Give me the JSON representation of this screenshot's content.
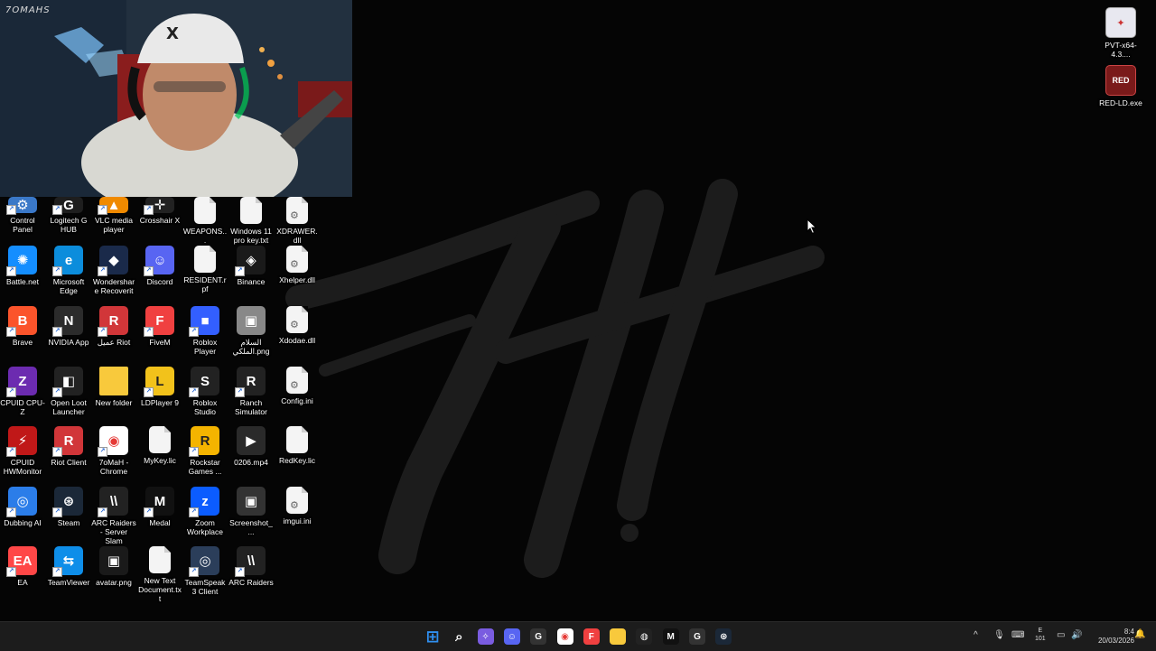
{
  "webcam": {
    "overlay_label": "7OMAHS"
  },
  "desktop_icons_left": [
    {
      "label": "Control Panel",
      "icon": "control-panel-icon",
      "color": "#3a78c8"
    },
    {
      "label": "Logitech G HUB",
      "icon": "logitech-ghub-icon",
      "color": "#1e1e1e"
    },
    {
      "label": "VLC media player",
      "icon": "vlc-icon",
      "color": "#f08a00"
    },
    {
      "label": "Crosshair X",
      "icon": "crosshair-x-icon",
      "color": "#222"
    },
    {
      "label": "WEAPONS...",
      "icon": "file-icon",
      "color": "#f4f4f4"
    },
    {
      "label": "Windows 11 pro key.txt",
      "icon": "text-file-icon",
      "color": "#f4f4f4"
    },
    {
      "label": "XDRAWER.dll",
      "icon": "dll-file-icon",
      "color": "#f4f4f4"
    },
    {
      "label": "Battle.net",
      "icon": "battlenet-icon",
      "color": "#148eff"
    },
    {
      "label": "Microsoft Edge",
      "icon": "edge-icon",
      "color": "#0c8ddc"
    },
    {
      "label": "Wondershare Recoverit",
      "icon": "recoverit-icon",
      "color": "#1a2a4a"
    },
    {
      "label": "Discord",
      "icon": "discord-icon",
      "color": "#5865f2"
    },
    {
      "label": "RESIDENT.rpf",
      "icon": "file-icon",
      "color": "#f4f4f4"
    },
    {
      "label": "Binance",
      "icon": "binance-icon",
      "color": "#1a1a1a"
    },
    {
      "label": "Xhelper.dll",
      "icon": "dll-file-icon",
      "color": "#f4f4f4"
    },
    {
      "label": "Brave",
      "icon": "brave-icon",
      "color": "#fb542b"
    },
    {
      "label": "NVIDIA App",
      "icon": "nvidia-icon",
      "color": "#2b2b2b"
    },
    {
      "label": "عميل Riot",
      "icon": "riot-client-icon",
      "color": "#d13639"
    },
    {
      "label": "FiveM",
      "icon": "fivem-icon",
      "color": "#f04040"
    },
    {
      "label": "Roblox Player",
      "icon": "roblox-icon",
      "color": "#335fff"
    },
    {
      "label": "السلام الملكي.png",
      "icon": "image-file-icon",
      "color": "#888"
    },
    {
      "label": "Xdodae.dll",
      "icon": "dll-file-icon",
      "color": "#f4f4f4"
    },
    {
      "label": "CPUID CPU-Z",
      "icon": "cpuz-icon",
      "color": "#6c2bb0"
    },
    {
      "label": "Open Loot Launcher",
      "icon": "openloot-icon",
      "color": "#222"
    },
    {
      "label": "New folder",
      "icon": "folder-icon",
      "color": "#f8c93c"
    },
    {
      "label": "LDPlayer 9",
      "icon": "ldplayer-icon",
      "color": "#f2c21b"
    },
    {
      "label": "Roblox Studio",
      "icon": "roblox-studio-icon",
      "color": "#222"
    },
    {
      "label": "Ranch Simulator",
      "icon": "ranch-simulator-icon",
      "color": "#222"
    },
    {
      "label": "Config.ini",
      "icon": "ini-file-icon",
      "color": "#f4f4f4"
    },
    {
      "label": "CPUID HWMonitor",
      "icon": "hwmonitor-icon",
      "color": "#c01818"
    },
    {
      "label": "Riot Client",
      "icon": "riot-client-icon",
      "color": "#d13639"
    },
    {
      "label": "7oMaH - Chrome",
      "icon": "chrome-icon",
      "color": "#ffffff"
    },
    {
      "label": "MyKey.lic",
      "icon": "file-icon",
      "color": "#f4f4f4"
    },
    {
      "label": "Rockstar Games ...",
      "icon": "rockstar-icon",
      "color": "#f4b400"
    },
    {
      "label": "0206.mp4",
      "icon": "video-file-icon",
      "color": "#2a2a2a"
    },
    {
      "label": "RedKey.lic",
      "icon": "file-icon",
      "color": "#f4f4f4"
    },
    {
      "label": "Dubbing AI",
      "icon": "dubbing-ai-icon",
      "color": "#2b7de9"
    },
    {
      "label": "Steam",
      "icon": "steam-icon",
      "color": "#1b2838"
    },
    {
      "label": "ARC Raiders - Server Slam",
      "icon": "arc-raiders-icon",
      "color": "#222"
    },
    {
      "label": "Medal",
      "icon": "medal-icon",
      "color": "#111"
    },
    {
      "label": "Zoom Workplace",
      "icon": "zoom-icon",
      "color": "#0b5cff"
    },
    {
      "label": "Screenshot_...",
      "icon": "image-file-icon",
      "color": "#333"
    },
    {
      "label": "imgui.ini",
      "icon": "ini-file-icon",
      "color": "#f4f4f4"
    },
    {
      "label": "EA",
      "icon": "ea-icon",
      "color": "#ff4747"
    },
    {
      "label": "TeamViewer",
      "icon": "teamviewer-icon",
      "color": "#0e8ee9"
    },
    {
      "label": "avatar.png",
      "icon": "image-file-icon",
      "color": "#1a1a1a"
    },
    {
      "label": "New Text Document.txt",
      "icon": "text-file-icon",
      "color": "#f4f4f4"
    },
    {
      "label": "TeamSpeak 3 Client",
      "icon": "teamspeak-icon",
      "color": "#2b3e5a"
    },
    {
      "label": "ARC Raiders",
      "icon": "arc-raiders-icon",
      "color": "#222"
    }
  ],
  "desktop_icons_right": [
    {
      "label": "PVT-x64-4.3....",
      "icon": "pvt-exe-icon"
    },
    {
      "label": "RED-LD.exe",
      "icon": "red-ld-exe-icon"
    }
  ],
  "taskbar": {
    "apps": [
      {
        "name": "start-button",
        "icon": "windows-logo-icon",
        "color": "#2f8ff0"
      },
      {
        "name": "search-button",
        "icon": "search-icon",
        "color": "transparent"
      },
      {
        "name": "copilot-button",
        "icon": "copilot-icon",
        "color": "#7a5ce0"
      },
      {
        "name": "discord-taskbar",
        "icon": "discord-icon",
        "color": "#5865f2"
      },
      {
        "name": "app-g-taskbar",
        "icon": "g-app-icon",
        "color": "#333"
      },
      {
        "name": "chrome-taskbar",
        "icon": "chrome-icon",
        "color": "#ffffff"
      },
      {
        "name": "fivem-taskbar",
        "icon": "fivem-icon",
        "color": "#f04040"
      },
      {
        "name": "explorer-taskbar",
        "icon": "folder-icon",
        "color": "#f8c93c"
      },
      {
        "name": "obs-taskbar",
        "icon": "obs-icon",
        "color": "#222"
      },
      {
        "name": "medal-taskbar",
        "icon": "medal-icon",
        "color": "#111"
      },
      {
        "name": "app-g2-taskbar",
        "icon": "g-app-icon",
        "color": "#333"
      },
      {
        "name": "steam-taskbar",
        "icon": "steam-icon",
        "color": "#1b2838"
      }
    ],
    "tray": {
      "chevron": "^",
      "keyboard_lang_top": "E",
      "keyboard_lang_bottom": "101",
      "clock_time": "8:4",
      "clock_date": "20/03/2026"
    }
  }
}
